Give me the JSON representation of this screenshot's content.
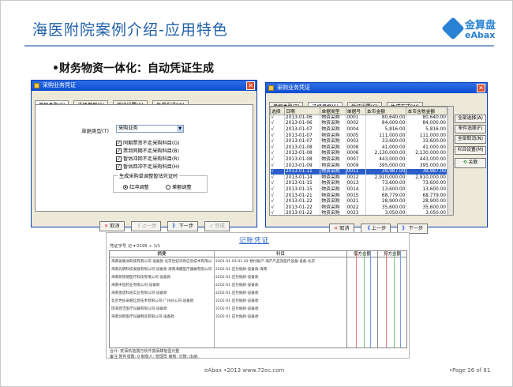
{
  "slide": {
    "title": "海医附院案例介绍-应用特色",
    "bullet": "•财务物资一体化：自动凭证生成",
    "logo_cn": "金算盘",
    "logo_en": "eAbax",
    "footer_center": "eAbax  •2013  www.72ec.com",
    "footer_page": "•Page 26 of 81",
    "accent_color": "#1f5fa8"
  },
  "win1": {
    "title": "采购业务凭证",
    "tabs": [
      "单据类型(T)",
      "选择单据(S)",
      "凭证设置(C)",
      "生成方式(W)"
    ],
    "type_label": "单据类型(T)",
    "type_value": "采购业务",
    "checks": [
      {
        "label": "同期票货不走采购科目(G)",
        "checked": true
      },
      {
        "label": "票到同期不走采购科目(B)",
        "checked": true
      },
      {
        "label": "暂估冲回不走采购科目(R)",
        "checked": true
      },
      {
        "label": "暂估回冲不走采购科目(H)",
        "checked": true
      }
    ],
    "group_label": "生成采购单调整暂估凭证时",
    "radio_a": "红冲调整",
    "radio_b": "差额调整",
    "btn_cancel": "取消",
    "btn_prev": "上一步",
    "btn_next": "下一步",
    "btn_finish": "完成"
  },
  "win2": {
    "title": "采购业务凭证",
    "tabs": [
      "单据类型(T)",
      "选择单据(S)",
      "凭证设置(C)",
      "生成方式(W)"
    ],
    "columns": [
      "选择",
      "日期",
      "单据类型",
      "单据号",
      "本币金额",
      "本币含税金额"
    ],
    "rows": [
      [
        "√",
        "2013-01-06",
        "物资采购",
        "0001",
        "80,640.00",
        "80,640.00"
      ],
      [
        "√",
        "2013-01-06",
        "物资采购",
        "0002",
        "84,000.00",
        "84,000.00"
      ],
      [
        "√",
        "2013-01-07",
        "物资采购",
        "0004",
        "5,816.00",
        "5,816.00"
      ],
      [
        "√",
        "2013-01-07",
        "物资采购",
        "0005",
        "111,000.00",
        "111,000.00"
      ],
      [
        "√",
        "2013-01-07",
        "物资采购",
        "0003",
        "33,600.00",
        "33,600.00"
      ],
      [
        "√",
        "2013-01-08",
        "物资采购",
        "0008",
        "41,000.00",
        "41,000.00"
      ],
      [
        "√",
        "2013-01-08",
        "物资采购",
        "0006",
        "2,130,000.00",
        "2,130,000.00"
      ],
      [
        "√",
        "2013-01-08",
        "物资采购",
        "0007",
        "443,000.00",
        "443,000.00"
      ],
      [
        "√",
        "2013-01-09",
        "物资采购",
        "0009",
        "395,000.00",
        "395,000.00"
      ],
      [
        "√",
        "2013-01-11",
        "物资采购",
        "0011",
        "39,987.00",
        "39,987.00"
      ],
      [
        "√",
        "2013-01-14",
        "物资采购",
        "0012",
        "2,910,000.00",
        "2,910,000.00"
      ],
      [
        "√",
        "2013-01-15",
        "物资采购",
        "0013",
        "73,600.00",
        "73,600.00"
      ],
      [
        "√",
        "2013-01-15",
        "物资采购",
        "0014",
        "13,600.00",
        "13,600.00"
      ],
      [
        "√",
        "2013-01-21",
        "物资采购",
        "0015",
        "68,779.00",
        "68,779.00"
      ],
      [
        "√",
        "2013-01-22",
        "物资采购",
        "0021",
        "28,900.00",
        "28,900.00"
      ],
      [
        "√",
        "2013-01-22",
        "物资采购",
        "0022",
        "35,600.00",
        "35,600.00"
      ],
      [
        "√",
        "2013-01-22",
        "物资采购",
        "0023",
        "3,050.00",
        "3,050.00"
      ]
    ],
    "highlight_row": 9,
    "side_buttons": [
      "全部选择(A)",
      "条件选择(F)",
      "全部取消(N)",
      "栏目设置(M)",
      "关联"
    ],
    "btn_cancel": "取消",
    "btn_prev": "上一步",
    "btn_next": "下一步"
  },
  "voucher": {
    "title": "记账凭证",
    "header": "凭证字号 记  ▾   0195  ÷  1/1",
    "col_summary": "摘要",
    "col_account": "科目",
    "col_debit": "借方金额",
    "col_credit": "贷方金额",
    "rows": [
      {
        "summary": "海南省联洲科技有限公司-设备款  北京世纪鸿商信息技术有限公司",
        "account": "2401-01-03-01-02 预付账户-海产产品及医疗设备-设备-北京"
      },
      {
        "summary": "海南光明科技发展有限公司-设备款  海南海健医疗器械有限公司-设备",
        "account": "2202-01 应付账款-设备款-海南"
      },
      {
        "summary": "海南新锐德医疗科技有限公司-设备款",
        "account": "2202-01 应付账款-设备款"
      },
      {
        "summary": "海南中昌药业有限公司-设备款",
        "account": "2202-01 应付账款-设备款"
      },
      {
        "summary": "海南金诺科技实业有限公司-设备款",
        "account": "2202-01 应付账款-设备款"
      },
      {
        "summary": "北京世纪卓越信息技术有限公司-广州分公司-设备款",
        "account": "2202-01 应付账款-设备款"
      },
      {
        "summary": "琼海佳洁医疗仪器有限公司-设备款",
        "account": "2202-01 应付账款-设备款"
      },
      {
        "summary": "海南创新医疗仪器制造有限公司-设备款",
        "account": "2202-01 应付账款-设备款"
      }
    ],
    "total_label": "合计:  贰佰玖拾捌万玖仟捌佰肆拾壹元整",
    "foot_line": "备注  附件张数: 0     制单人: 管理员     审核:     记账:     出纳:"
  }
}
